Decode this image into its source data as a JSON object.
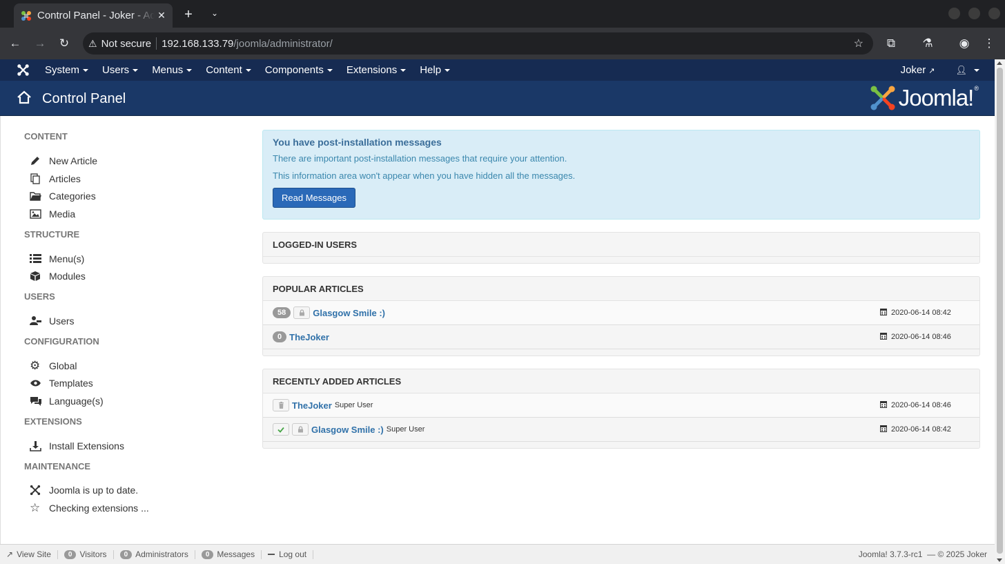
{
  "browser": {
    "tab_title": "Control Panel - Joker - Administration",
    "address_warning": "Not secure",
    "address_host": "192.168.133.79",
    "address_path": "/joomla/administrator/"
  },
  "navbar": {
    "menus": [
      "System",
      "Users",
      "Menus",
      "Content",
      "Components",
      "Extensions",
      "Help"
    ],
    "site_link": "Joker"
  },
  "subhead": {
    "title": "Control Panel",
    "logo_text": "Joomla!",
    "logo_reg": "®"
  },
  "sidebar": [
    {
      "heading": "CONTENT",
      "items": [
        {
          "label": "New Article",
          "icon": "pencil-icon"
        },
        {
          "label": "Articles",
          "icon": "copy-icon"
        },
        {
          "label": "Categories",
          "icon": "folder-icon"
        },
        {
          "label": "Media",
          "icon": "image-icon"
        }
      ]
    },
    {
      "heading": "STRUCTURE",
      "items": [
        {
          "label": "Menu(s)",
          "icon": "list-icon"
        },
        {
          "label": "Modules",
          "icon": "cube-icon"
        }
      ]
    },
    {
      "heading": "USERS",
      "items": [
        {
          "label": "Users",
          "icon": "users-icon"
        }
      ]
    },
    {
      "heading": "CONFIGURATION",
      "items": [
        {
          "label": "Global",
          "icon": "gear-icon"
        },
        {
          "label": "Templates",
          "icon": "eye-icon"
        },
        {
          "label": "Language(s)",
          "icon": "comments-icon"
        }
      ]
    },
    {
      "heading": "EXTENSIONS",
      "items": [
        {
          "label": "Install Extensions",
          "icon": "download-icon"
        }
      ]
    },
    {
      "heading": "MAINTENANCE",
      "items": [
        {
          "label": "Joomla is up to date.",
          "icon": "joomla-icon"
        },
        {
          "label": "Checking extensions ...",
          "icon": "star-icon"
        }
      ]
    }
  ],
  "alert": {
    "title": "You have post-installation messages",
    "line1": "There are important post-installation messages that require your attention.",
    "line2": "This information area won't appear when you have hidden all the messages.",
    "button": "Read Messages"
  },
  "logged_in": {
    "title": "LOGGED-IN USERS"
  },
  "popular": {
    "title": "POPULAR ARTICLES",
    "rows": [
      {
        "hits": "58",
        "title": "Glasgow Smile :)",
        "date": "2020-06-14 08:42",
        "locked": true
      },
      {
        "hits": "0",
        "title": "TheJoker",
        "date": "2020-06-14 08:46",
        "locked": false
      }
    ]
  },
  "recent": {
    "title": "RECENTLY ADDED ARTICLES",
    "rows": [
      {
        "title": "TheJoker",
        "author": "Super User",
        "date": "2020-06-14 08:46",
        "status": "trashed"
      },
      {
        "title": "Glasgow Smile :)",
        "author": "Super User",
        "date": "2020-06-14 08:42",
        "status": "published"
      }
    ]
  },
  "status": {
    "view_site": "View Site",
    "visitors_count": "0",
    "visitors": "Visitors",
    "admins_count": "0",
    "admins": "Administrators",
    "messages_count": "0",
    "messages": "Messages",
    "logout": "Log out",
    "version": "Joomla! 3.7.3-rc1",
    "copyright": "— © 2025 Joker"
  },
  "colors": {
    "navbar": "#162b52",
    "subhead": "#1a3867",
    "link": "#3071a9",
    "alert_bg": "#d9edf7",
    "button": "#2a69b8"
  }
}
